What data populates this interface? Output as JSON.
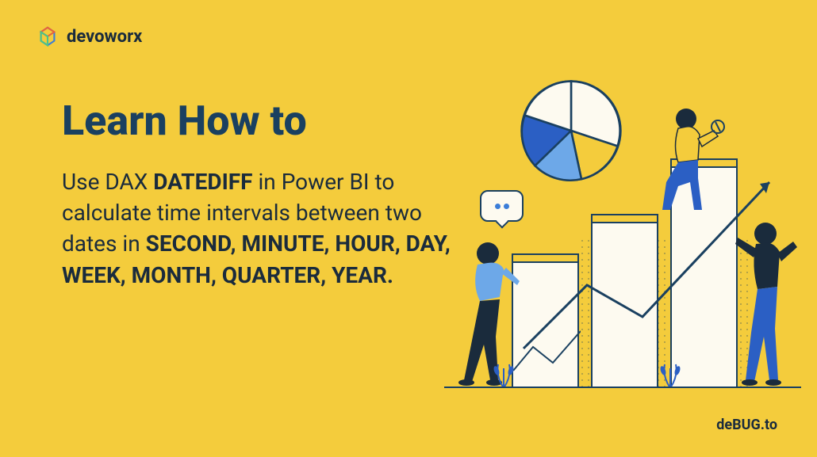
{
  "brand": {
    "name": "devoworx"
  },
  "title": "Learn How to",
  "body": {
    "prefix": "Use DAX ",
    "bold1": "DATEDIFF",
    "mid": " in Power BI to calculate time intervals between two dates in ",
    "bold2": "SECOND, MINUTE, HOUR, DAY, WEEK, MONTH, QUARTER, YEAR.",
    "suffix": ""
  },
  "footer": {
    "pre": "de",
    "caps": "BUG",
    "post": ".to"
  }
}
